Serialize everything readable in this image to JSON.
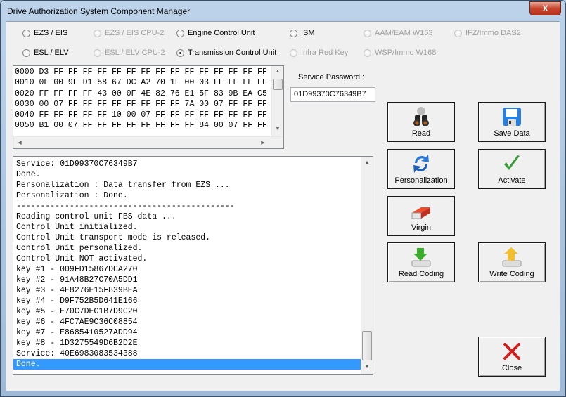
{
  "window": {
    "title": "Drive Authorization System Component Manager",
    "close_label": "X"
  },
  "radios": [
    {
      "label": "EZS / EIS",
      "enabled": true,
      "checked": false
    },
    {
      "label": "EZS / EIS CPU-2",
      "enabled": false,
      "checked": false
    },
    {
      "label": "Engine Control Unit",
      "enabled": true,
      "checked": false
    },
    {
      "label": "ISM",
      "enabled": true,
      "checked": false
    },
    {
      "label": "AAM/EAM W163",
      "enabled": false,
      "checked": false
    },
    {
      "label": "IFZ/Immo DAS2",
      "enabled": false,
      "checked": false
    },
    {
      "label": "ESL / ELV",
      "enabled": true,
      "checked": false
    },
    {
      "label": "ESL / ELV CPU-2",
      "enabled": false,
      "checked": false
    },
    {
      "label": "Transmission Control Unit",
      "enabled": true,
      "checked": true
    },
    {
      "label": "Infra Red Key",
      "enabled": false,
      "checked": false
    },
    {
      "label": "WSP/Immo W168",
      "enabled": false,
      "checked": false
    }
  ],
  "hex_lines": [
    "0000 D3 FF FF FF FF FF FF FF FF FF FF FF FF FF FF FF",
    "0010 0F 00 9F D1 58 67 DC A2 70 1F 00 03 FF FF FF FF",
    "0020 FF FF FF FF 43 00 0F 4E 82 76 E1 5F 83 9B EA C5",
    "0030 00 07 FF FF FF FF FF FF FF FF 7A 00 07 FF FF FF",
    "0040 FF FF FF FF FF 10 00 07 FF FF FF FF FF FF FF FF",
    "0050 B1 00 07 FF FF FF FF FF FF FF FF 84 00 07 FF FF"
  ],
  "service_password": {
    "label": "Service Password :",
    "value": "01D99370C76349B7"
  },
  "log_lines": [
    "Service: 01D99370C76349B7",
    "Done.",
    "Personalization : Data transfer from EZS ...",
    "Personalization : Done.",
    "---------------------------------------------",
    "Reading control unit FBS data ...",
    "Control Unit initialized.",
    "Control Unit transport mode is released.",
    "Control Unit personalized.",
    "Control Unit NOT activated.",
    "key #1 - 009FD15867DCA270",
    "key #2 - 91A48B27C70A5DD1",
    "key #3 - 4E8276E15F839BEA",
    "key #4 - D9F752B5D641E166",
    "key #5 - E70C7DEC1B7D9C20",
    "key #6 - 4FC7AE9C36C08854",
    "key #7 - E8685410527ADD94",
    "key #8 - 1D3275549D6B2D2E",
    "Service: 40E6983083534388",
    "Done."
  ],
  "buttons": {
    "read": "Read",
    "save": "Save Data",
    "personalization": "Personalization",
    "activate": "Activate",
    "virgin": "Virgin",
    "read_coding": "Read Coding",
    "write_coding": "Write Coding",
    "close": "Close"
  },
  "colors": {
    "selection": "#3399ff",
    "check_green": "#3a9a3a",
    "close_red": "#d02020"
  }
}
